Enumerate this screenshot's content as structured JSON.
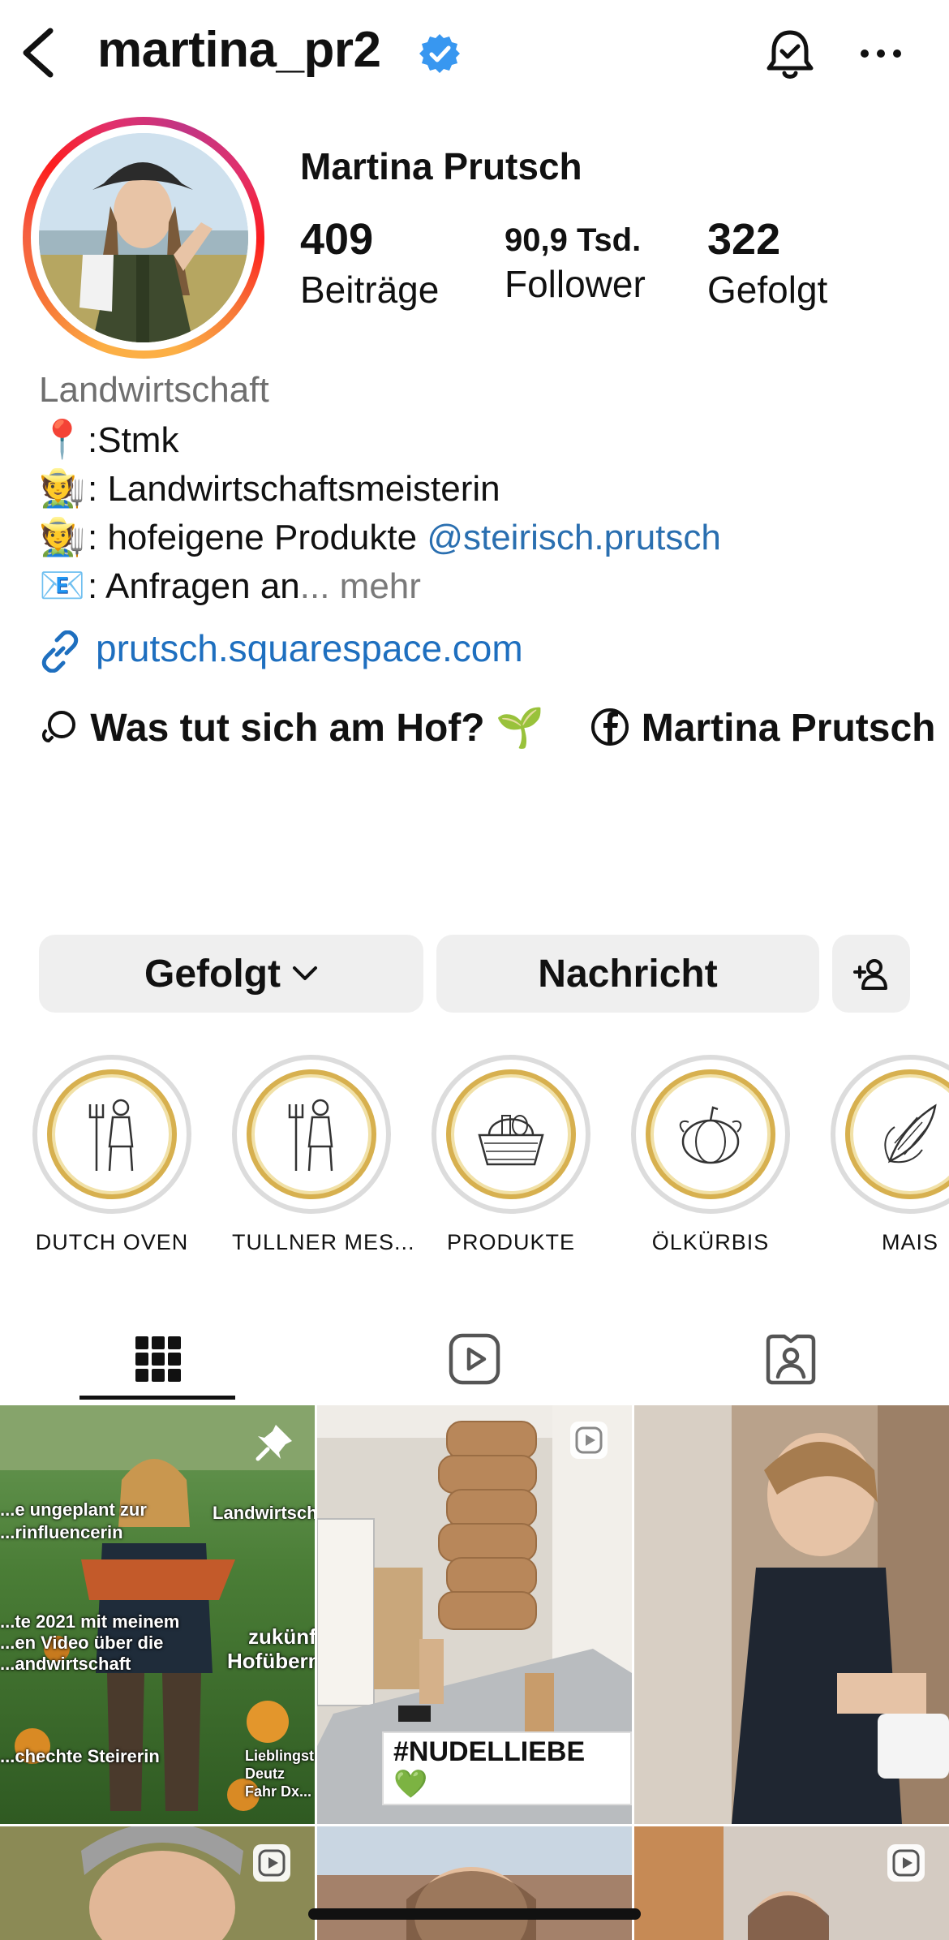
{
  "header": {
    "username": "martina_pr2",
    "verified_icon": "verified-badge-icon",
    "back_icon": "chevron-left-icon",
    "notifications_icon": "bell-check-icon",
    "more_icon": "more-horizontal-icon"
  },
  "profile": {
    "display_name": "Martina Prutsch",
    "stats": [
      {
        "value": "409",
        "label": "Beiträge"
      },
      {
        "value": "90,9 Tsd.",
        "label": "Follower"
      },
      {
        "value": "322",
        "label": "Gefolgt"
      }
    ],
    "category": "Landwirtschaft",
    "bio": {
      "line1_emoji": "📍",
      "line1_text": ":Stmk",
      "line2_emoji": "🧑‍🌾",
      "line2_text": ": Landwirtschaftsmeisterin",
      "line3_emoji": "🧑‍🌾",
      "line3_text": ": hofeigene Produkte ",
      "line3_mention": "@steirisch.prutsch",
      "line4_emoji": "📧",
      "line4_text": ": Anfragen an",
      "line4_ellipsis": "... ",
      "more": "mehr"
    },
    "link": "prutsch.squarespace.com",
    "threads_label": "Was tut sich am Hof? 🌱",
    "facebook_label": "Martina Prutsch"
  },
  "actions": {
    "follow_label": "Gefolgt",
    "message_label": "Nachricht"
  },
  "highlights": [
    {
      "label": "DUTCH OVEN",
      "icon": "farmer-pitchfork-icon"
    },
    {
      "label": "TULLNER MES...",
      "icon": "farmer-pitchfork-icon"
    },
    {
      "label": "PRODUKTE",
      "icon": "basket-icon"
    },
    {
      "label": "ÖLKÜRBIS",
      "icon": "pumpkin-icon"
    },
    {
      "label": "MAIS",
      "icon": "corn-icon"
    }
  ],
  "tabs": [
    {
      "name": "posts",
      "icon": "grid-icon",
      "active": true
    },
    {
      "name": "reels",
      "icon": "reels-icon",
      "active": false
    },
    {
      "name": "tagged",
      "icon": "tagged-person-icon",
      "active": false
    }
  ],
  "posts": {
    "post1_overlay": [
      "...e ungeplant zur",
      "...rinfluencerin",
      "Landwirtschaftsme...",
      "...te 2021 mit meinem",
      "...en Video über die",
      "...andwirtschaft",
      "zukünftige",
      "Hofübernehm...",
      "...chechte Steirerin",
      "Lieblingstrak...",
      "Deutz Fahr Dx..."
    ],
    "post2_caption": "#NUDELLIEBE 💚"
  },
  "colors": {
    "link_blue": "#1e6fbf",
    "verified_blue": "#3897f0",
    "button_bg": "#efefef",
    "highlight_gold": "#d7b04f"
  }
}
